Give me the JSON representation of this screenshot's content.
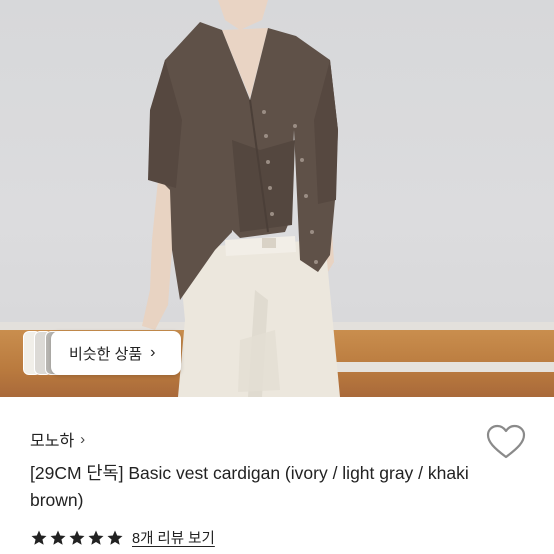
{
  "similar": {
    "label": "비슷한 상품",
    "chevron": "›"
  },
  "product": {
    "brand": "모노하",
    "brand_chevron": "›",
    "title": "[29CM 단독] Basic vest cardigan (ivory / light gray / khaki brown)",
    "rating": 5,
    "review_link": "8개 리뷰 보기"
  },
  "colors": {
    "cardigan": "#5f5148",
    "pants": "#ebe6dc",
    "wall": "#d9d9db",
    "floor": "#b97a3e",
    "star": "#222222",
    "heart_stroke": "#8a8a8a"
  },
  "icons": [
    "heart-icon",
    "star-icon",
    "chevron-right-icon"
  ]
}
